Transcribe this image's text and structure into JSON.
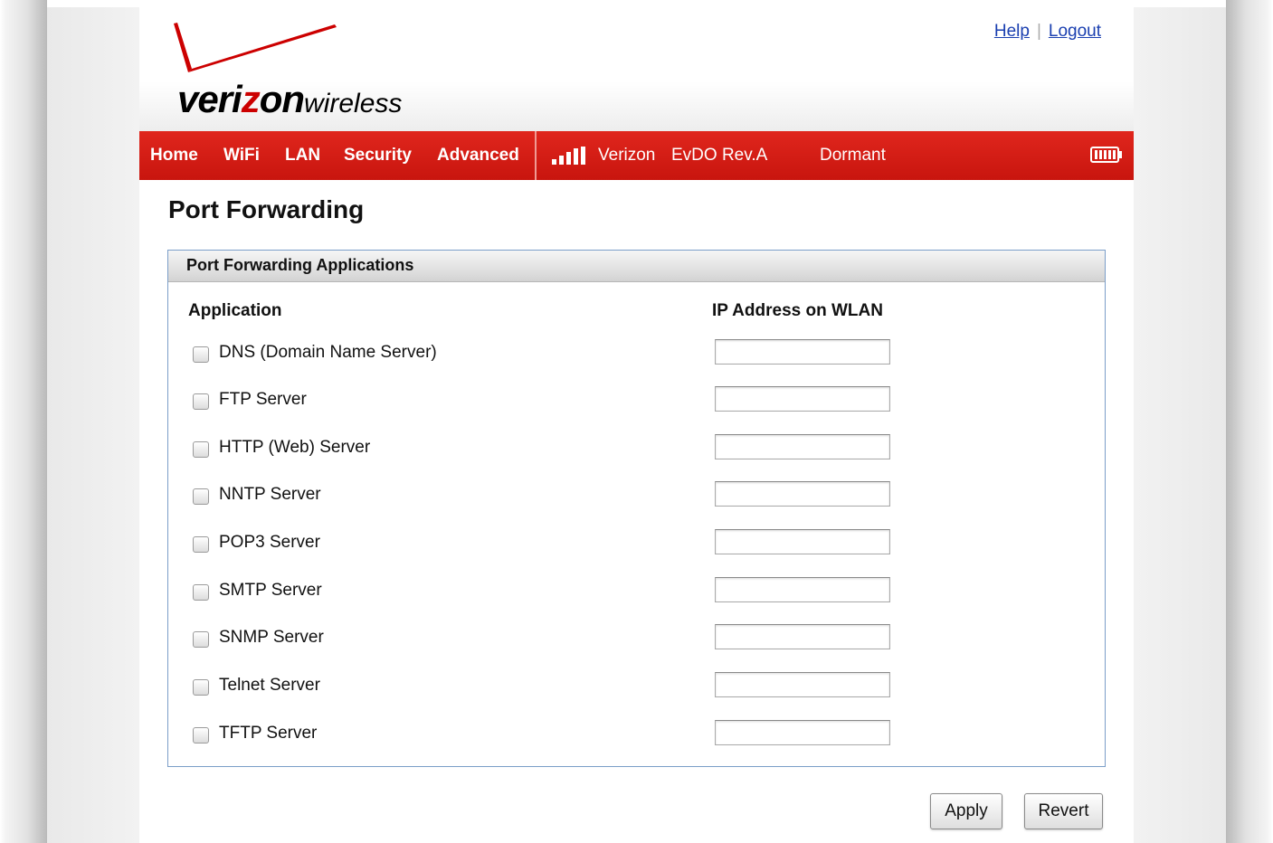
{
  "brand": {
    "name_prefix": "veri",
    "name_z": "z",
    "name_suffix": "on",
    "name_tail": "wireless",
    "accent_color": "#cc0000"
  },
  "top_links": {
    "help": "Help",
    "separator": "|",
    "logout": "Logout"
  },
  "nav": {
    "items": [
      "Home",
      "WiFi",
      "LAN",
      "Security",
      "Advanced"
    ],
    "signal_icon": "signal-bars-icon",
    "carrier": "Verizon",
    "network": "EvDO Rev.A",
    "connection_state": "Dormant",
    "battery_icon": "battery-icon"
  },
  "page": {
    "title": "Port Forwarding"
  },
  "panel": {
    "title": "Port Forwarding Applications",
    "col_application": "Application",
    "col_ip": "IP Address on WLAN",
    "rows": [
      {
        "label": "DNS (Domain Name Server)",
        "checked": false,
        "ip": ""
      },
      {
        "label": "FTP Server",
        "checked": false,
        "ip": ""
      },
      {
        "label": "HTTP (Web) Server",
        "checked": false,
        "ip": ""
      },
      {
        "label": "NNTP Server",
        "checked": false,
        "ip": ""
      },
      {
        "label": "POP3 Server",
        "checked": false,
        "ip": ""
      },
      {
        "label": "SMTP Server",
        "checked": false,
        "ip": ""
      },
      {
        "label": "SNMP Server",
        "checked": false,
        "ip": ""
      },
      {
        "label": "Telnet Server",
        "checked": false,
        "ip": ""
      },
      {
        "label": "TFTP Server",
        "checked": false,
        "ip": ""
      }
    ]
  },
  "actions": {
    "apply": "Apply",
    "revert": "Revert"
  }
}
